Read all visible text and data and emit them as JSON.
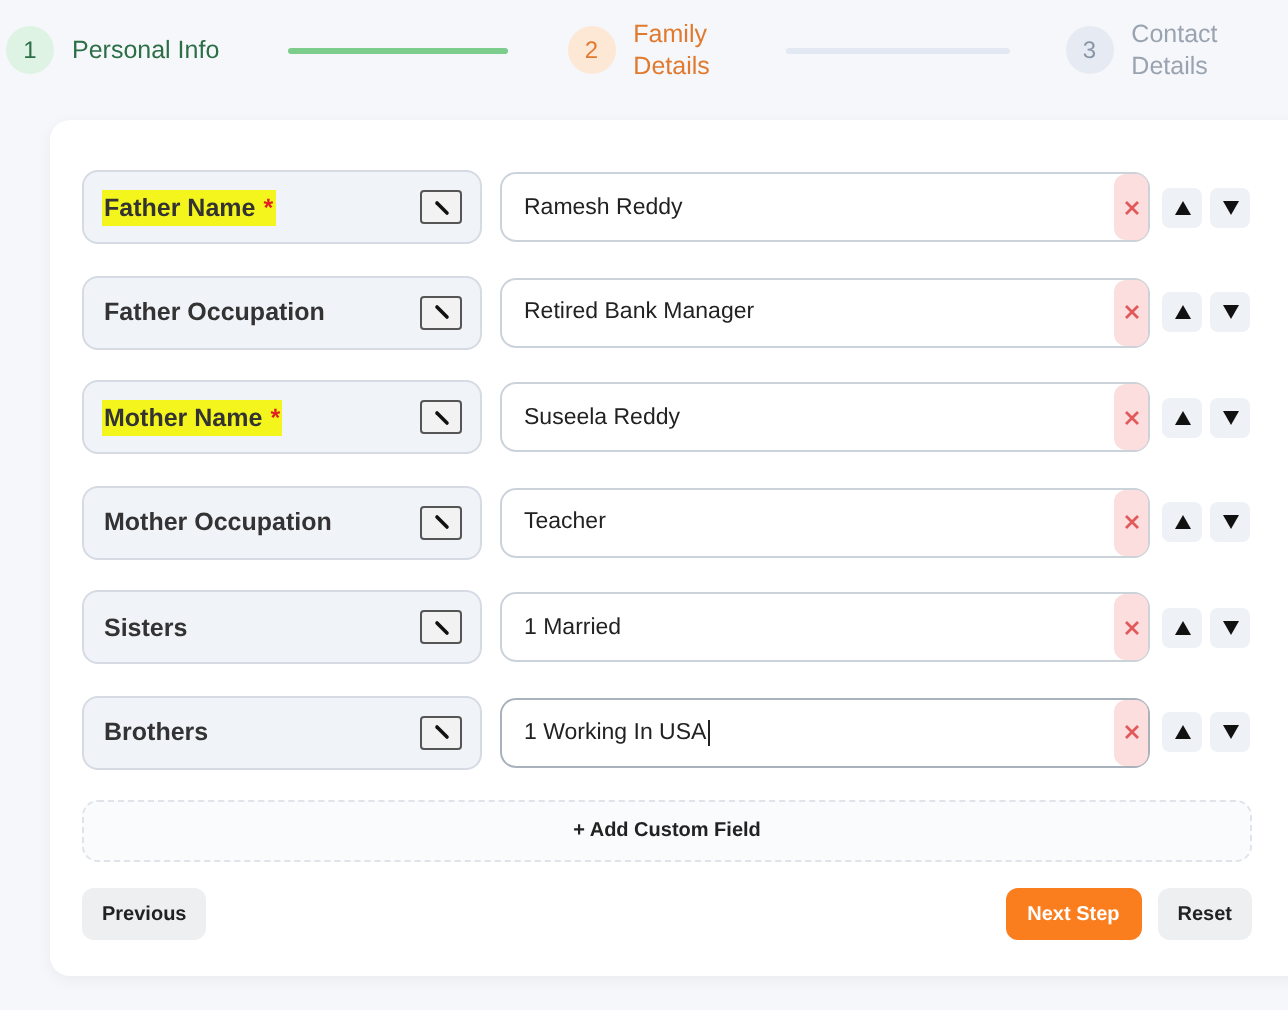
{
  "steps": [
    {
      "number": "1",
      "label": "Personal Info",
      "completed": true,
      "selected": false
    },
    {
      "number": "2",
      "label": "Family Details",
      "completed": false,
      "selected": true
    },
    {
      "number": "3",
      "label": "Contact Details",
      "completed": false,
      "selected": false
    }
  ],
  "fields": [
    {
      "label": "Father Name",
      "required": true,
      "highlighted": true,
      "value": "Ramesh Reddy",
      "focused": false
    },
    {
      "label": "Father Occupation",
      "required": false,
      "highlighted": false,
      "value": "Retired Bank Manager",
      "focused": false
    },
    {
      "label": "Mother Name",
      "required": true,
      "highlighted": true,
      "value": "Suseela Reddy",
      "focused": false
    },
    {
      "label": "Mother Occupation",
      "required": false,
      "highlighted": false,
      "value": "Teacher",
      "focused": false
    },
    {
      "label": "Sisters",
      "required": false,
      "highlighted": false,
      "value": "1 Married",
      "focused": false
    },
    {
      "label": "Brothers",
      "required": false,
      "highlighted": false,
      "value": "1 Working In USA",
      "focused": true
    }
  ],
  "required_mark": "*",
  "add_field_button": "+ Add Custom Field",
  "buttons": {
    "previous": "Previous",
    "next": "Next Step",
    "reset": "Reset"
  }
}
